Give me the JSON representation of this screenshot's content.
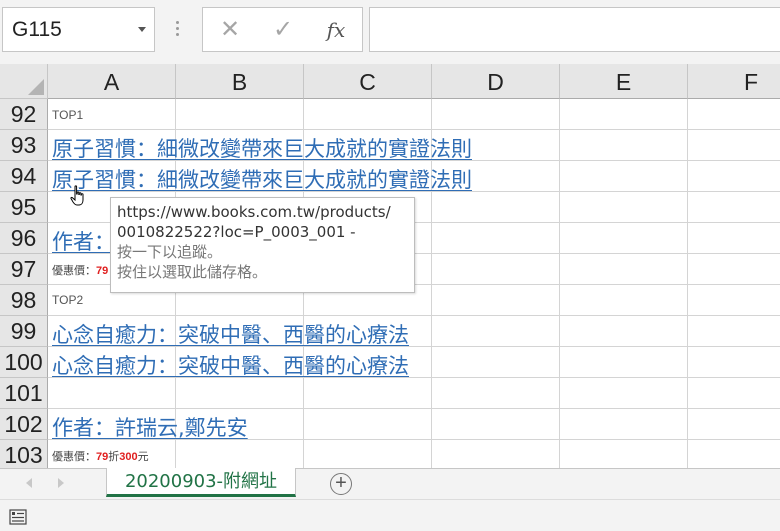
{
  "formula_bar": {
    "name_box": "G115",
    "cancel_icon": "✕",
    "enter_icon": "✓",
    "fx_label": "fx",
    "formula": ""
  },
  "columns": [
    "A",
    "B",
    "C",
    "D",
    "E",
    "F"
  ],
  "rows": [
    "92",
    "93",
    "94",
    "95",
    "96",
    "97",
    "98",
    "99",
    "100",
    "101",
    "102",
    "103"
  ],
  "cells": {
    "r92": "TOP1",
    "r93": "原子習慣：細微改變帶來巨大成就的實證法則",
    "r94": "原子習慣：細微改變帶來巨大成就的實證法則",
    "r96": "作者：",
    "r97_label": "優惠價：",
    "r97_value": "79",
    "r98": "TOP2",
    "r99": "心念自癒力：突破中醫、西醫的心療法",
    "r100": "心念自癒力：突破中醫、西醫的心療法",
    "r102": "作者：許瑞云,鄭先安",
    "r103_label": "優惠價：",
    "r103_discount": "79",
    "r103_mid": "折",
    "r103_price": "300",
    "r103_unit": "元"
  },
  "tooltip": {
    "line1": "https://www.books.com.tw/products/",
    "line2": "0010822522?loc=P_0003_001 -",
    "line3": "按一下以追蹤。",
    "line4": "按住以選取此儲存格。"
  },
  "sheets": {
    "active_tab": "20200903-附網址",
    "add_icon": "+"
  },
  "colors": {
    "link": "#2f6db5",
    "accent_green": "#217346",
    "price_red": "#e02020"
  }
}
